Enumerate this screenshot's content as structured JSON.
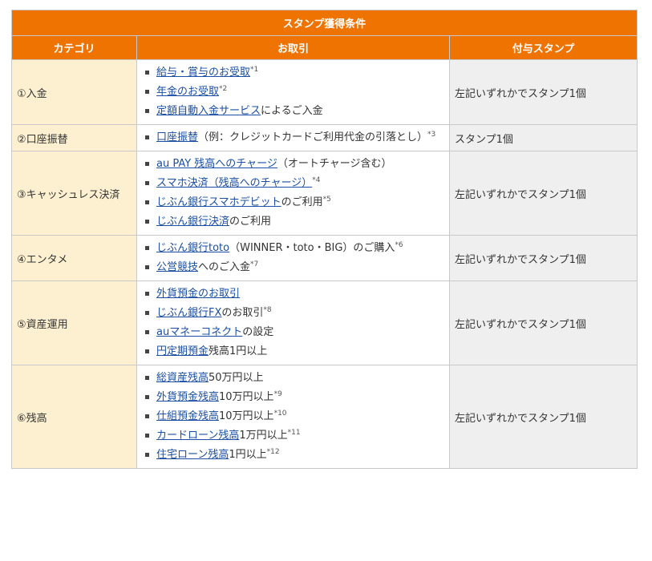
{
  "table": {
    "title": "スタンプ獲得条件",
    "headers": [
      "カテゴリ",
      "お取引",
      "付与スタンプ"
    ]
  },
  "rows": [
    {
      "category": "①入金",
      "stamp": "左記いずれかでスタンプ1個",
      "items": [
        {
          "link": "給与・賞与のお受取",
          "rest": "",
          "sup": "*1"
        },
        {
          "link": "年金のお受取",
          "rest": "",
          "sup": "*2"
        },
        {
          "link": "定額自動入金サービス",
          "rest": "によるご入金",
          "sup": ""
        }
      ]
    },
    {
      "category": "②口座振替",
      "stamp": "スタンプ1個",
      "items": [
        {
          "link": "口座振替",
          "rest": "（例：クレジットカードご利用代金の引落とし）",
          "sup": "*3"
        }
      ]
    },
    {
      "category": "③キャッシュレス決済",
      "stamp": "左記いずれかでスタンプ1個",
      "items": [
        {
          "link": "au PAY 残高へのチャージ",
          "rest": "（オートチャージ含む）",
          "sup": ""
        },
        {
          "link": "スマホ決済（残高へのチャージ）",
          "rest": "",
          "sup": "*4"
        },
        {
          "link": "じぶん銀行スマホデビット",
          "rest": "のご利用",
          "sup": "*5"
        },
        {
          "link": "じぶん銀行決済",
          "rest": "のご利用",
          "sup": ""
        }
      ]
    },
    {
      "category": "④エンタメ",
      "stamp": "左記いずれかでスタンプ1個",
      "items": [
        {
          "link": "じぶん銀行toto",
          "rest": "（WINNER・toto・BIG）のご購入",
          "sup": "*6"
        },
        {
          "link": "公営競技",
          "rest": "へのご入金",
          "sup": "*7"
        }
      ]
    },
    {
      "category": "⑤資産運用",
      "stamp": "左記いずれかでスタンプ1個",
      "items": [
        {
          "link": "外貨預金のお取引",
          "rest": "",
          "sup": ""
        },
        {
          "link": "じぶん銀行FX",
          "rest": "のお取引",
          "sup": "*8"
        },
        {
          "link": "auマネーコネクト",
          "rest": "の設定",
          "sup": ""
        },
        {
          "link": "円定期預金",
          "rest": "残高1円以上",
          "sup": ""
        }
      ]
    },
    {
      "category": "⑥残高",
      "stamp": "左記いずれかでスタンプ1個",
      "items": [
        {
          "link": "総資産残高",
          "rest": "50万円以上",
          "sup": ""
        },
        {
          "link": "外貨預金残高",
          "rest": "10万円以上",
          "sup": "*9"
        },
        {
          "link": "仕組預金残高",
          "rest": "10万円以上",
          "sup": "*10"
        },
        {
          "link": "カードローン残高",
          "rest": "1万円以上",
          "sup": "*11"
        },
        {
          "link": "住宅ローン残高",
          "rest": "1円以上",
          "sup": "*12"
        }
      ]
    }
  ]
}
